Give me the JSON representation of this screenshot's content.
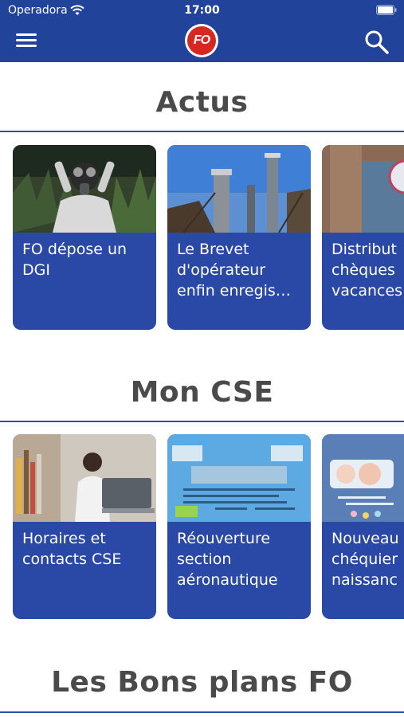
{
  "status_bar": {
    "carrier": "Operadora",
    "time": "17:00"
  },
  "header": {
    "logo_text": "FO"
  },
  "sections": [
    {
      "title": "Actus",
      "cards": [
        {
          "label": "FO dépose un\nDGI",
          "image": "person-gas-mask-photo"
        },
        {
          "label": "Le Brevet\nd'opérateur\nenfin enregis…",
          "image": "refinery-photo"
        },
        {
          "label": "Distribut\nchèques\nvacances",
          "image": "wood-panel-photo"
        }
      ]
    },
    {
      "title": "Mon CSE",
      "cards": [
        {
          "label": "Horaires et\ncontacts CSE",
          "image": "woman-laptop-photo"
        },
        {
          "label": "Réouverture\nsection\naéronautique",
          "image": "aeronautic-flyer"
        },
        {
          "label": "Nouveau\nchéquier\nnaissanc",
          "image": "birth-card-photo"
        }
      ]
    },
    {
      "title": "Les Bons plans FO",
      "cards": []
    }
  ],
  "colors": {
    "header": "#21439a",
    "card": "#2a48a6",
    "title": "#4a4a4a",
    "line": "#2f4fa6"
  }
}
